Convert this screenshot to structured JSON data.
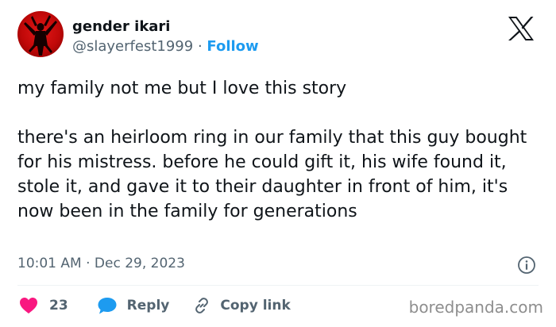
{
  "author": {
    "display_name": "gender ikari",
    "handle": "@slayerfest1999",
    "separator": "·",
    "follow_label": "Follow"
  },
  "tweet": {
    "text": "my family not me but I love this story\n\nthere's an heirloom ring in our family that this guy bought for his mistress. before he could gift it, his wife found it, stole it, and gave it to their daughter in front of him, it's now been in the family for generations",
    "time": "10:01 AM",
    "separator": "·",
    "date": "Dec 29, 2023"
  },
  "actions": {
    "like_count": "23",
    "reply_label": "Reply",
    "copy_link_label": "Copy link"
  },
  "icons": {
    "avatar": "avatar-image",
    "platform": "x-logo-icon",
    "info": "info-icon",
    "like": "heart-icon",
    "reply": "speech-bubble-icon",
    "copy": "link-icon"
  },
  "watermark": "boredpanda.com",
  "colors": {
    "accent": "#1d9bf0",
    "heart": "#f91880",
    "text": "#0f1419",
    "secondary": "#536471"
  }
}
